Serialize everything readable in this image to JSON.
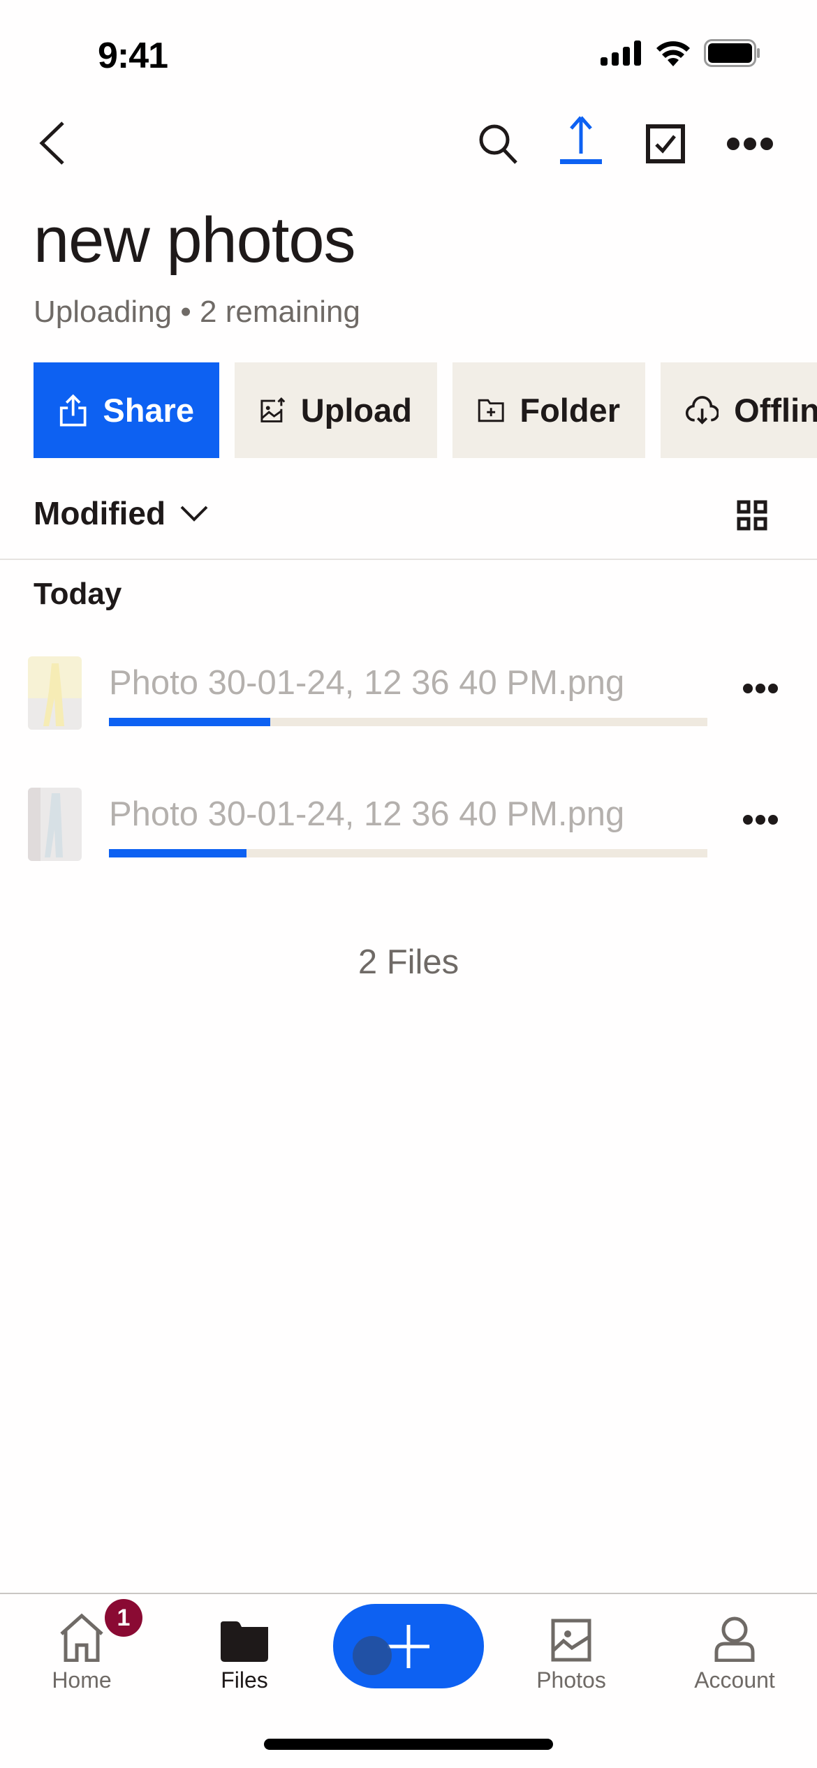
{
  "status_bar": {
    "time": "9:41"
  },
  "nav": {
    "icons": [
      "back-icon",
      "search-icon",
      "upload-icon",
      "select-checkbox-icon",
      "more-icon"
    ],
    "accent_color": "#0d61f2"
  },
  "header": {
    "title": "new photos",
    "subtitle": "Uploading • 2 remaining"
  },
  "actions": [
    {
      "label": "Share",
      "icon": "share-icon",
      "primary": true
    },
    {
      "label": "Upload",
      "icon": "upload-image-icon"
    },
    {
      "label": "Folder",
      "icon": "new-folder-icon"
    },
    {
      "label": "Offline",
      "icon": "cloud-download-icon"
    }
  ],
  "sort": {
    "label": "Modified",
    "view_icon": "grid-view-icon"
  },
  "section": {
    "title": "Today"
  },
  "files": [
    {
      "name": "Photo 30-01-24, 12 36 40 PM.png",
      "progress": 0.27
    },
    {
      "name": "Photo 30-01-24, 12 36 40 PM.png",
      "progress": 0.23
    }
  ],
  "file_count": "2 Files",
  "tabbar": {
    "tabs": [
      {
        "label": "Home",
        "icon": "home-icon",
        "badge": "1"
      },
      {
        "label": "Files",
        "icon": "folder-icon",
        "active": true
      },
      {
        "label": "Photos",
        "icon": "photo-icon"
      },
      {
        "label": "Account",
        "icon": "account-icon"
      }
    ],
    "fab_icon": "plus-icon",
    "badge_color": "#8a0a33"
  }
}
